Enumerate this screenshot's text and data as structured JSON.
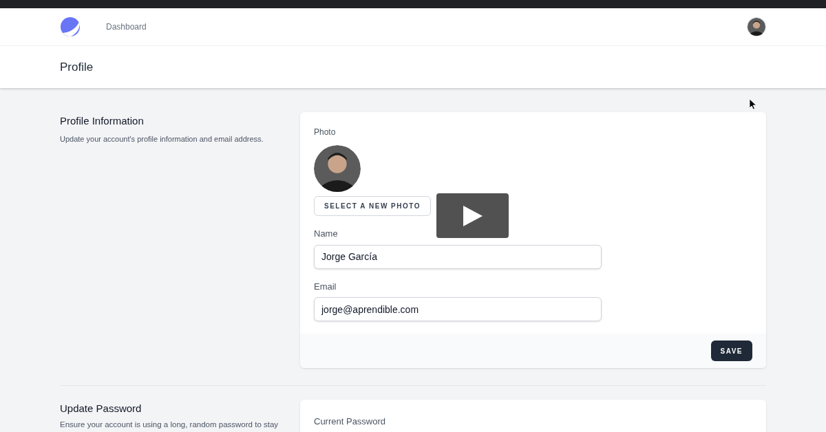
{
  "nav": {
    "links": [
      {
        "label": "Dashboard",
        "selected": false
      }
    ]
  },
  "page_header": {
    "title": "Profile"
  },
  "sections": [
    {
      "title": "Profile Information",
      "description": "Update your account's profile information and email address.",
      "photo": {
        "label": "Photo",
        "button": "SELECT A NEW PHOTO"
      },
      "fields": [
        {
          "label": "Name",
          "value": "Jorge García"
        },
        {
          "label": "Email",
          "value": "jorge@aprendible.com"
        }
      ],
      "button": "SAVE"
    },
    {
      "title": "Update Password",
      "description": "Ensure your account is using a long, random password to stay",
      "fields": [
        {
          "label": "Current Password"
        }
      ]
    }
  ]
}
